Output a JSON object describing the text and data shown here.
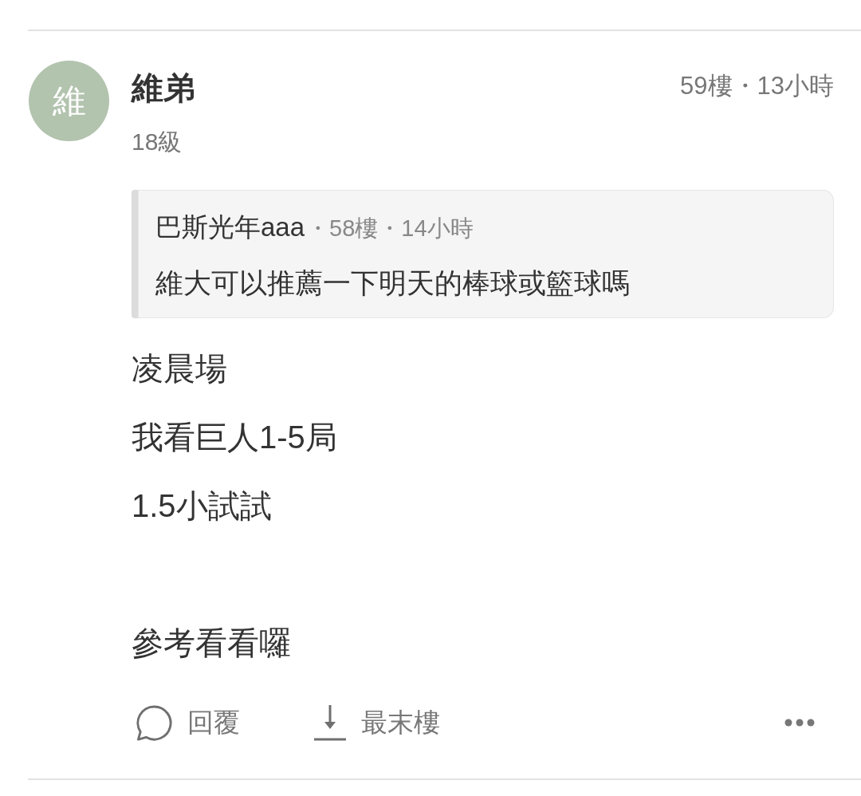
{
  "post": {
    "avatar": {
      "initial": "維"
    },
    "author": "維弟",
    "rank": "18級",
    "meta": "59樓・13小時",
    "quote": {
      "author": "巴斯光年aaa",
      "meta": "・58樓・14小時",
      "text": "維大可以推薦一下明天的棒球或籃球嗎"
    },
    "paragraphs": [
      [
        "凌晨場",
        "我看巨人1-5局",
        "1.5小試試"
      ],
      [
        "參考看看囉"
      ]
    ],
    "actions": [
      {
        "kind": "reply",
        "label": "回覆"
      },
      {
        "kind": "last_floor",
        "label": "最末樓"
      },
      {
        "kind": "more"
      }
    ]
  }
}
